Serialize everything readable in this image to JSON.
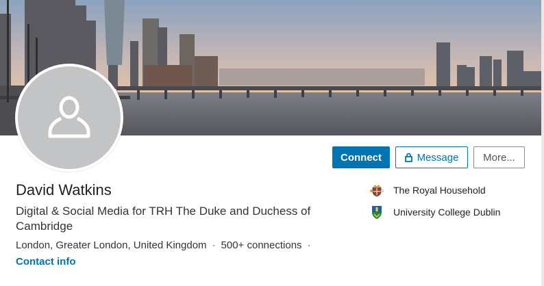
{
  "profile": {
    "name": "David Watkins",
    "headline": "Digital & Social Media for TRH The Duke and Duchess of Cambridge",
    "location": "London, Greater London, United Kingdom",
    "connections": "500+ connections",
    "contact_info_label": "Contact info"
  },
  "actions": {
    "connect_label": "Connect",
    "message_label": "Message",
    "more_label": "More..."
  },
  "organizations": [
    {
      "name": "The Royal Household",
      "logo": "royal-crest-icon"
    },
    {
      "name": "University College Dublin",
      "logo": "ucd-crest-icon"
    }
  ],
  "colors": {
    "accent": "#0073b1",
    "avatar_bg": "#c2c4c6"
  }
}
